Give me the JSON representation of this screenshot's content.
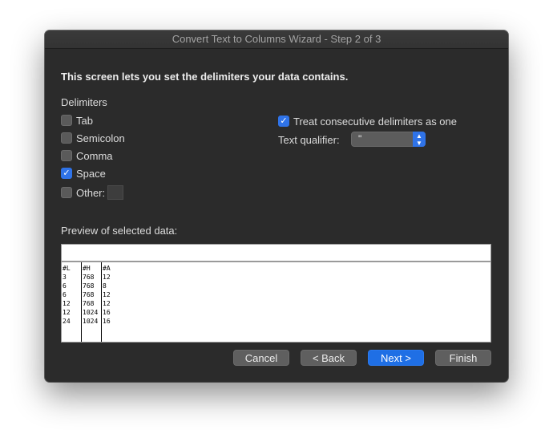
{
  "window": {
    "title": "Convert Text to Columns Wizard - Step 2 of 3"
  },
  "heading": "This screen lets you set the delimiters your data contains.",
  "delimiters": {
    "label": "Delimiters",
    "tab": {
      "label": "Tab",
      "checked": false
    },
    "semicolon": {
      "label": "Semicolon",
      "checked": false
    },
    "comma": {
      "label": "Comma",
      "checked": false
    },
    "space": {
      "label": "Space",
      "checked": true
    },
    "other": {
      "label": "Other:",
      "checked": false,
      "value": ""
    }
  },
  "consecutive": {
    "label": "Treat consecutive delimiters as one",
    "checked": true
  },
  "qualifier": {
    "label": "Text qualifier:",
    "value": "\""
  },
  "preview": {
    "label": "Preview of selected data:",
    "columns": [
      {
        "header": "#L",
        "cells": [
          "3",
          "6",
          "6",
          "12",
          "12",
          "24"
        ]
      },
      {
        "header": "#H",
        "cells": [
          "768",
          "768",
          "768",
          "768",
          "1024",
          "1024"
        ]
      },
      {
        "header": "#A",
        "cells": [
          "12",
          "8",
          "12",
          "12",
          "16",
          "16"
        ]
      }
    ]
  },
  "buttons": {
    "cancel": "Cancel",
    "back": "< Back",
    "next": "Next >",
    "finish": "Finish"
  },
  "colors": {
    "accent": "#2f73e8",
    "window_bg": "#2b2b2b"
  }
}
